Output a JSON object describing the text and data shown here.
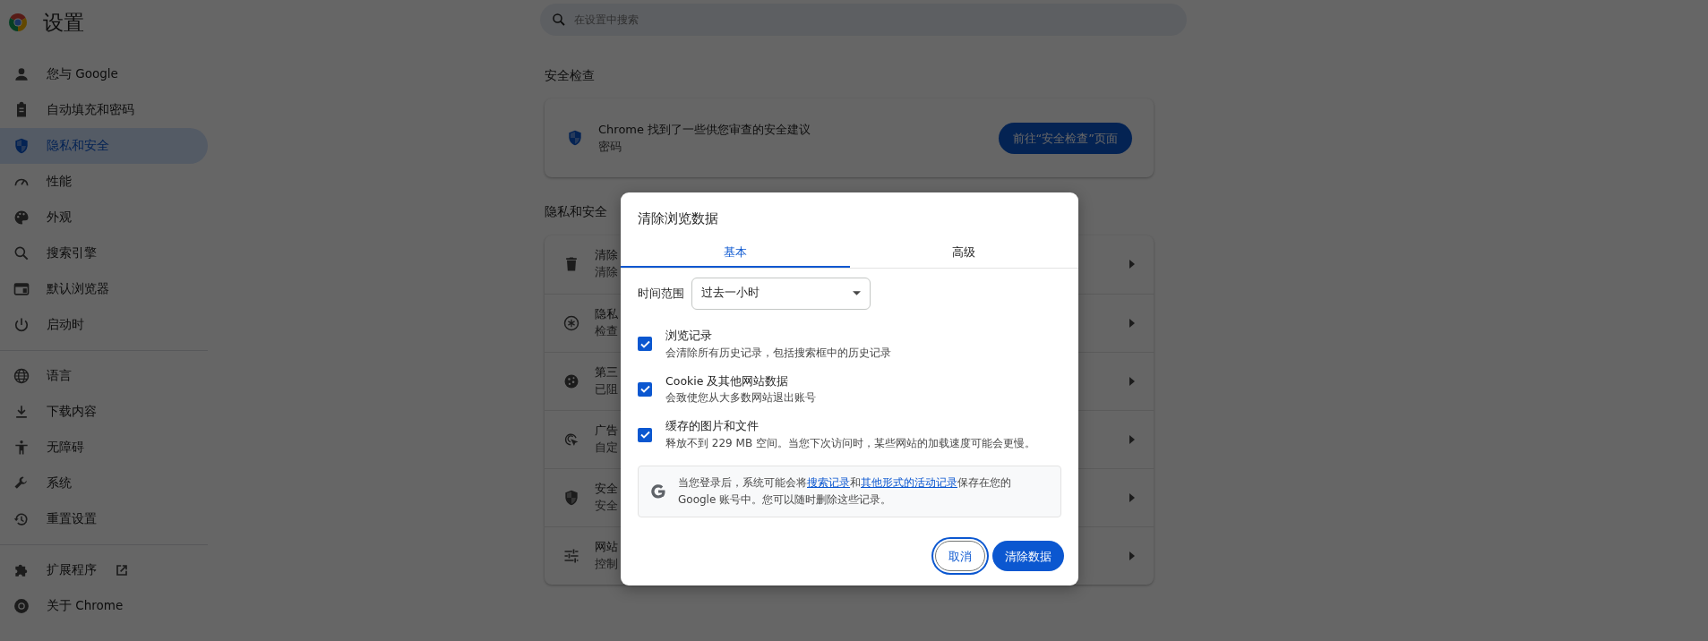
{
  "app": {
    "title": "设置"
  },
  "sidebar": {
    "groups": [
      [
        {
          "label": "您与 Google",
          "selected": false
        },
        {
          "label": "自动填充和密码",
          "selected": false
        },
        {
          "label": "隐私和安全",
          "selected": true
        },
        {
          "label": "性能",
          "selected": false
        },
        {
          "label": "外观",
          "selected": false
        },
        {
          "label": "搜索引擎",
          "selected": false
        },
        {
          "label": "默认浏览器",
          "selected": false
        },
        {
          "label": "启动时",
          "selected": false
        }
      ],
      [
        {
          "label": "语言",
          "selected": false
        },
        {
          "label": "下载内容",
          "selected": false
        },
        {
          "label": "无障碍",
          "selected": false
        },
        {
          "label": "系统",
          "selected": false
        },
        {
          "label": "重置设置",
          "selected": false
        }
      ],
      [
        {
          "label": "扩展程序",
          "selected": false,
          "external": true
        },
        {
          "label": "关于 Chrome",
          "selected": false
        }
      ]
    ]
  },
  "search": {
    "placeholder": "在设置中搜索"
  },
  "safety_check": {
    "heading": "安全检查",
    "title": "Chrome 找到了一些供您审查的安全建议",
    "subtitle": "密码",
    "button": "前往“安全检查”页面"
  },
  "privacy": {
    "heading": "隐私和安全",
    "rows": [
      {
        "title": "清除",
        "subtitle": "清除"
      },
      {
        "title": "隐私",
        "subtitle": "检查"
      },
      {
        "title": "第三",
        "subtitle": "已阻"
      },
      {
        "title": "广告",
        "subtitle": "自定"
      },
      {
        "title": "安全",
        "subtitle": "安全"
      },
      {
        "title": "网站",
        "subtitle": "控制"
      }
    ]
  },
  "dialog": {
    "title": "清除浏览数据",
    "tabs": [
      {
        "label": "基本",
        "selected": true
      },
      {
        "label": "高级",
        "selected": false
      }
    ],
    "time_range": {
      "label": "时间范围",
      "value": "过去一小时"
    },
    "options": [
      {
        "title": "浏览记录",
        "description": "会清除所有历史记录，包括搜索框中的历史记录",
        "checked": true
      },
      {
        "title": "Cookie 及其他网站数据",
        "description": "会致使您从大多数网站退出账号",
        "checked": true
      },
      {
        "title": "缓存的图片和文件",
        "description": "释放不到 229 MB 空间。当您下次访问时，某些网站的加载速度可能会更慢。",
        "checked": true
      }
    ],
    "notice": [
      {
        "kind": "text",
        "text": "当您登录后，系统可能会将"
      },
      {
        "kind": "link",
        "text": "搜索记录"
      },
      {
        "kind": "text",
        "text": "和"
      },
      {
        "kind": "link",
        "text": "其他形式的活动记录"
      },
      {
        "kind": "text",
        "text": "保存在您的 Google 账号中。您可以随时删除这些记录。"
      }
    ],
    "buttons": [
      {
        "label": "取消",
        "kind": "outline",
        "focused": true
      },
      {
        "label": "清除数据",
        "kind": "primary",
        "focused": false
      }
    ]
  }
}
